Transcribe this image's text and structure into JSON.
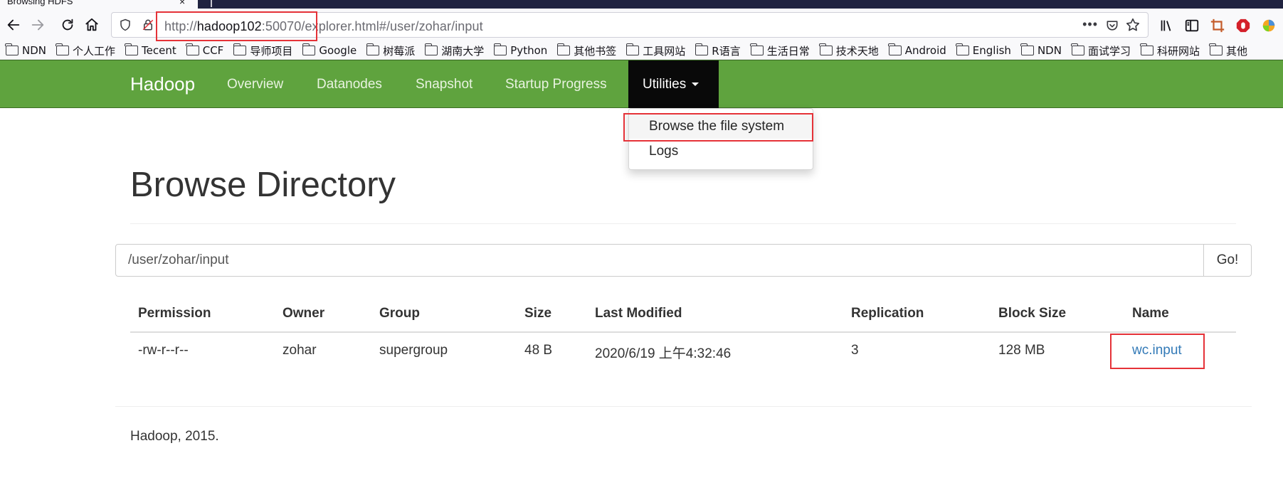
{
  "browser": {
    "tab_title": "Browsing HDFS",
    "tab_close": "×",
    "url": {
      "scheme": "http://",
      "host": "hadoop102",
      "port": ":50070",
      "path": "/explorer.html#/user/zohar/input"
    },
    "url_more": "•••"
  },
  "bookmarks": [
    {
      "label": "NDN"
    },
    {
      "label": "个人工作"
    },
    {
      "label": "Tecent"
    },
    {
      "label": "CCF"
    },
    {
      "label": "导师项目"
    },
    {
      "label": "Google"
    },
    {
      "label": "树莓派"
    },
    {
      "label": "湖南大学"
    },
    {
      "label": "Python"
    },
    {
      "label": "其他书签"
    },
    {
      "label": "工具网站"
    },
    {
      "label": "R语言"
    },
    {
      "label": "生活日常"
    },
    {
      "label": "技术天地"
    },
    {
      "label": "Android"
    },
    {
      "label": "English"
    },
    {
      "label": "NDN"
    },
    {
      "label": "面试学习"
    },
    {
      "label": "科研网站"
    },
    {
      "label": "其他"
    }
  ],
  "navbar": {
    "brand": "Hadoop",
    "items": [
      "Overview",
      "Datanodes",
      "Snapshot",
      "Startup Progress"
    ],
    "utilities": "Utilities"
  },
  "dropdown": {
    "items": [
      "Browse the file system",
      "Logs"
    ]
  },
  "page": {
    "title": "Browse Directory",
    "path_value": "/user/zohar/input",
    "go_label": "Go!"
  },
  "table": {
    "headers": [
      "Permission",
      "Owner",
      "Group",
      "Size",
      "Last Modified",
      "Replication",
      "Block Size",
      "Name"
    ],
    "rows": [
      {
        "permission": "-rw-r--r--",
        "owner": "zohar",
        "group": "supergroup",
        "size": "48 B",
        "last_modified": "2020/6/19 上午4:32:46",
        "replication": "3",
        "block_size": "128 MB",
        "name": "wc.input"
      }
    ]
  },
  "footer": {
    "text": "Hadoop, 2015."
  },
  "colors": {
    "navbar_green": "#5fa33e",
    "active_nav": "#090909",
    "link_blue": "#337ab7",
    "highlight_red": "#e53238"
  }
}
